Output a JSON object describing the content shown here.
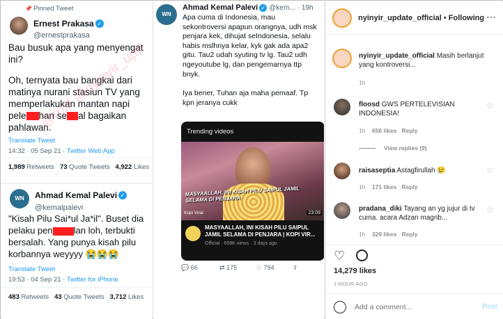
{
  "tweet1": {
    "pinned_label": "Pinned Tweet",
    "author_name": "Ernest Prakasa",
    "author_handle": "@ernestprakasa",
    "text_a": "Bau busuk apa yang menyengat ini?",
    "text_b1": "Oh, ternyata bau bangkai dari matinya nurani stasiun TV yang memperlakukan mantan napi pele",
    "text_b2": "han se",
    "text_b3": "al bagaikan pahlawan.",
    "translate": "Translate Tweet",
    "time": "14:32 · 05 Sep 21 · ",
    "source": "Twitter Web App",
    "retweets": "1,989",
    "retweets_label": "Retweets",
    "quotes": "73",
    "quotes_label": "Quote Tweets",
    "likes": "4,922",
    "likes_label": "Likes"
  },
  "tweet2": {
    "author_name": "Ahmad Kemal Palevi",
    "author_handle": "@kemalpalevi",
    "text_a": "\"Kisah Pilu Sai*ul Ja*il\". Buset dia pelaku pen",
    "text_b": "lan loh, terbukti bersalah. Yang punya kisah pilu korbannya weyyyy 😭😭😭",
    "translate": "Translate Tweet",
    "time": "19:53 · 04 Sep 21 · ",
    "source": "Twitter for iPhone",
    "retweets": "483",
    "retweets_label": "Retweets",
    "quotes": "43",
    "quotes_label": "Quote Tweets",
    "likes": "3,712",
    "likes_label": "Likes"
  },
  "tweet3": {
    "author_name": "Ahmad Kemal Palevi",
    "author_handle": "@kem...",
    "time_ago": "· 19h",
    "text_a": "Apa cuma di Indonesia, mau sekontroversi apapun orangnya, udh msk penjara kek, dihujat seIndonesia, selalu habis mslhnya kelar, kyk gak ada apa2 gitu. Tau2 udah syuting tv lg. Tau2 udh ngeyoutube lg, dan pengemarnya ttp bnyk.",
    "text_b": "Iya bener, Tuhan aja maha pemaaf. Tp kpn jeranya cukk",
    "card_header": "Trending videos",
    "video_caption": "MASYAALLAH, INI KISAH PILU SAIPUL JAMIL SELAMA DI PENJARA",
    "video_tag": "Kopi Viral",
    "video_duration": "23:09",
    "video_title": "MASYAALLAH, INI KISAH PILU SAIPUL JAMIL SELAMA DI PENJARA | KOPI VIR...",
    "video_meta": "Official · 658K views · 3 days ago",
    "replies": "66",
    "retweets": "175",
    "likes": "794"
  },
  "instagram": {
    "header_user": "nyinyir_update_official",
    "follow_label": "• Following",
    "caption_user": "nyinyir_update_official",
    "caption_text": "Masih berlanjut yang kontroversi...",
    "caption_time": "1h",
    "comments": [
      {
        "user": "floosd",
        "text": "GWS PERTELEVISIAN INDONESIA!",
        "time": "1h",
        "likes": "656 likes",
        "reply": "Reply",
        "view_replies": "View replies (9)"
      },
      {
        "user": "raisaseptia",
        "text": "Astagfirullah 😢",
        "time": "1h",
        "likes": "171 likes",
        "reply": "Reply"
      },
      {
        "user": "pradana_diki",
        "text": "Tayang an yg jujur di tv cuma. acara Adzan magrib...",
        "time": "1h",
        "likes": "329 likes",
        "reply": "Reply"
      }
    ],
    "likes_count": "14,279 likes",
    "post_time": "1 HOUR AGO",
    "comment_placeholder": "Add a comment...",
    "post_label": "Post"
  },
  "watermark": "@rost @nyinyir_upd"
}
